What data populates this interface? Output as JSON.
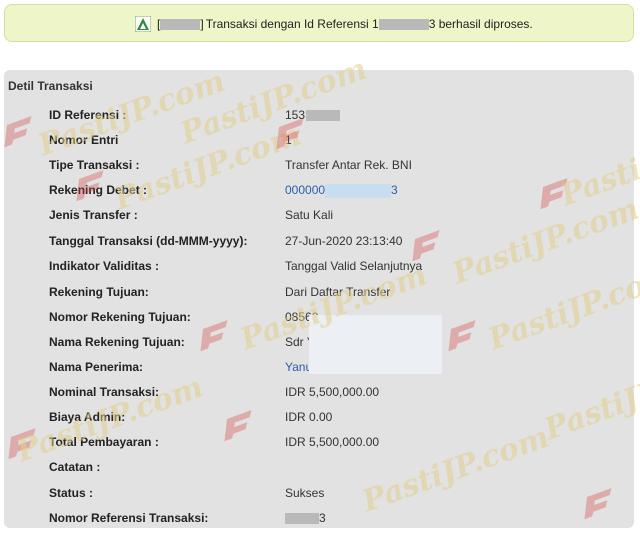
{
  "banner": {
    "message_part1": "Transaksi dengan Id Referensi 1",
    "message_part2": "3 berhasil diproses.",
    "icon": "success-triangle-icon"
  },
  "panel": {
    "title": "Detil Transaksi",
    "rows": [
      {
        "label": "ID Referensi :",
        "value": "153"
      },
      {
        "label": "Nomor Entri",
        "value": "1"
      },
      {
        "label": "Tipe Transaksi :",
        "value": "Transfer Antar Rek. BNI"
      },
      {
        "label": "Rekening Debet :",
        "value_prefix": "000000",
        "value_suffix": "3"
      },
      {
        "label": "Jenis Transfer :",
        "value": "Satu Kali"
      },
      {
        "label": "Tanggal Transaksi (dd-MMM-yyyy):",
        "value": "27-Jun-2020 23:13:40"
      },
      {
        "label": "Indikator Validitas :",
        "value": "Tanggal Valid Selanjutnya"
      },
      {
        "label": "Rekening Tujuan:",
        "value": "Dari Daftar Transfer"
      },
      {
        "label": "Nomor Rekening Tujuan:",
        "value": "08560"
      },
      {
        "label": "Nama Rekening Tujuan:",
        "value": "Sdr Y"
      },
      {
        "label": "Nama Penerima:",
        "value": "Yanu"
      },
      {
        "label": "Nominal Transaksi:",
        "value": "IDR 5,500,000.00"
      },
      {
        "label": "Biaya Admin:",
        "value": "IDR 0.00"
      },
      {
        "label": "Total Pembayaran :",
        "value": "IDR 5,500,000.00"
      },
      {
        "label": "Catatan :",
        "value": ""
      },
      {
        "label": "Status :",
        "value": "Sukses"
      },
      {
        "label": "Nomor Referensi Transaksi:",
        "value_suffix": "3"
      }
    ]
  },
  "watermark": {
    "text": "PastiJP.com"
  },
  "colors": {
    "banner_bg": "#eef5c8",
    "panel_bg": "#e2e2e2",
    "link": "#2a5db0",
    "success_icon": "#2e8b3a"
  }
}
